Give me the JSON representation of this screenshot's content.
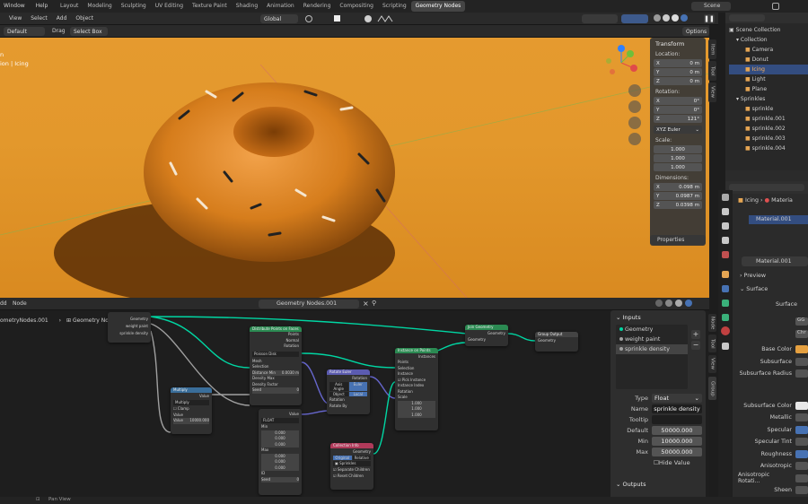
{
  "topbar": {
    "menu": [
      "Window",
      "Help"
    ],
    "workspaces": [
      "Layout",
      "Modeling",
      "Sculpting",
      "UV Editing",
      "Texture Paint",
      "Shading",
      "Animation",
      "Rendering",
      "Compositing",
      "Scripting",
      "Geometry Nodes"
    ],
    "active_workspace": "Geometry Nodes",
    "scene": "Scene"
  },
  "viewport_header": {
    "menus": [
      "View",
      "Select",
      "Add",
      "Object"
    ],
    "transform_orientation": "Global",
    "orientation": "Default",
    "drag_label": "Drag",
    "select_mode": "Select Box",
    "options": "Options",
    "overlay_text": [
      "n",
      "ion | Icing"
    ]
  },
  "n_panel": {
    "title": "Transform",
    "location_label": "Location:",
    "location": [
      {
        "axis": "X",
        "value": "0 m"
      },
      {
        "axis": "Y",
        "value": "0 m"
      },
      {
        "axis": "Z",
        "value": "0 m"
      }
    ],
    "rotation_label": "Rotation:",
    "rotation": [
      {
        "axis": "X",
        "value": "0°"
      },
      {
        "axis": "Y",
        "value": "0°"
      },
      {
        "axis": "Z",
        "value": "121°"
      }
    ],
    "rotation_mode": "XYZ Euler",
    "scale_label": "Scale:",
    "scale": [
      "1.000",
      "1.000",
      "1.000"
    ],
    "dimensions_label": "Dimensions:",
    "dimensions": [
      {
        "axis": "X",
        "value": "0.098 m"
      },
      {
        "axis": "Y",
        "value": "0.0987 m"
      },
      {
        "axis": "Z",
        "value": "0.0398 m"
      }
    ],
    "properties": "Properties",
    "tabs": [
      "Item",
      "Tool",
      "View"
    ]
  },
  "outliner": {
    "root": "Scene Collection",
    "items": [
      {
        "name": "Collection",
        "level": 1,
        "selected": false
      },
      {
        "name": "Camera",
        "level": 2,
        "selected": false
      },
      {
        "name": "Donut",
        "level": 2,
        "selected": false
      },
      {
        "name": "Icing",
        "level": 2,
        "selected": true
      },
      {
        "name": "Light",
        "level": 2,
        "selected": false
      },
      {
        "name": "Plane",
        "level": 2,
        "selected": false
      },
      {
        "name": "Sprinkles",
        "level": 1,
        "selected": false
      },
      {
        "name": "sprinkle",
        "level": 2,
        "selected": false
      },
      {
        "name": "sprinkle.001",
        "level": 2,
        "selected": false
      },
      {
        "name": "sprinkle.002",
        "level": 2,
        "selected": false
      },
      {
        "name": "sprinkle.003",
        "level": 2,
        "selected": false
      },
      {
        "name": "sprinkle.004",
        "level": 2,
        "selected": false
      }
    ]
  },
  "properties": {
    "breadcrumb_object": "Icing",
    "breadcrumb_material": "Materia",
    "material_slot": "Material.001",
    "material_name": "Material.001",
    "preview": "Preview",
    "surface_section": "Surface",
    "surface_label": "Surface",
    "dist_1": "GG",
    "dist_2": "Chr",
    "rows": [
      "Base Color",
      "Subsurface",
      "Subsurface Radius",
      "Subsurface Color",
      "Metallic",
      "Specular",
      "Specular Tint",
      "Roughness",
      "Anisotropic",
      "Anisotropic Rotati...",
      "Sheen"
    ]
  },
  "node_editor": {
    "menus": [
      "dd",
      "Node"
    ],
    "tree_name": "Geometry Nodes.001",
    "breadcrumb_left": "ometryNodes.001",
    "breadcrumb_right": "Geometry Nodes.001",
    "nodes": {
      "group_input": {
        "title": "",
        "outputs": [
          "Geometry",
          "weight paint",
          "sprinkle density"
        ]
      },
      "distribute": {
        "title": "Distribute Points on Faces",
        "outputs": [
          "Points",
          "Normal",
          "Rotation"
        ],
        "mode": "Poisson Disk",
        "inputs": [
          "Mesh",
          "Selection",
          "Distance Min",
          "Density Max",
          "Density Factor",
          "Seed"
        ],
        "distance_min": "0.0030 m",
        "seed": "0"
      },
      "random_value": {
        "title": "",
        "mode": "FLOAT",
        "out": "Value",
        "min_label": "Min",
        "max_label": "Max",
        "min": [
          "0.000",
          "0.000",
          "0.000"
        ],
        "max": [
          "0.000",
          "0.000",
          "0.000"
        ],
        "id": "ID",
        "seed": "Seed",
        "seed_val": "0"
      },
      "multiply": {
        "title": "Multiply",
        "out": "Value",
        "op": "Multiply",
        "clamp": "Clamp",
        "in": "Value",
        "val": "Value",
        "val_num": "10000.000"
      },
      "rotate_euler": {
        "title": "Rotate Euler",
        "out": "Rotation",
        "mode_a": "Axis Angle",
        "mode_b": "Euler",
        "local": "Object",
        "local_b": "Local",
        "in_rot": "Rotation",
        "in_by": "Rotate By"
      },
      "instance": {
        "title": "Instance on Points",
        "out": "Instances",
        "inputs": [
          "Points",
          "Selection",
          "Instance",
          "Pick Instance",
          "Instance Index",
          "Rotation",
          "Scale"
        ],
        "scale": [
          "1.000",
          "1.000",
          "1.000"
        ]
      },
      "join": {
        "title": "Join Geometry",
        "out": "Geometry",
        "in": "Geometry"
      },
      "group_output": {
        "title": "Group Output",
        "in": "Geometry"
      },
      "collection_info": {
        "title": "Collection Info",
        "out": "Geometry",
        "mode_a": "Original",
        "mode_b": "Relative",
        "collection": "Sprinkles",
        "sep": "Separate Children",
        "reset": "Reset Children"
      }
    }
  },
  "node_sidebar": {
    "inputs_title": "Inputs",
    "inputs": [
      "Geometry",
      "weight paint",
      "sprinkle density"
    ],
    "selected_input": "sprinkle density",
    "type_label": "Type",
    "type_value": "Float",
    "name_label": "Name",
    "name_value": "sprinkle density",
    "tooltip_label": "Tooltip",
    "tooltip_value": "",
    "default_label": "Default",
    "default_value": "50000.000",
    "min_label": "Min",
    "min_value": "10000.000",
    "max_label": "Max",
    "max_value": "50000.000",
    "hide_value": "Hide Value",
    "outputs_title": "Outputs",
    "tabs": [
      "Node",
      "Tool",
      "View",
      "Group"
    ]
  },
  "statusbar": {
    "text": "Pan View"
  },
  "colors": {
    "accent": "#334d80",
    "geometry_link": "#00d6a3",
    "header": "#2a2a2a"
  }
}
